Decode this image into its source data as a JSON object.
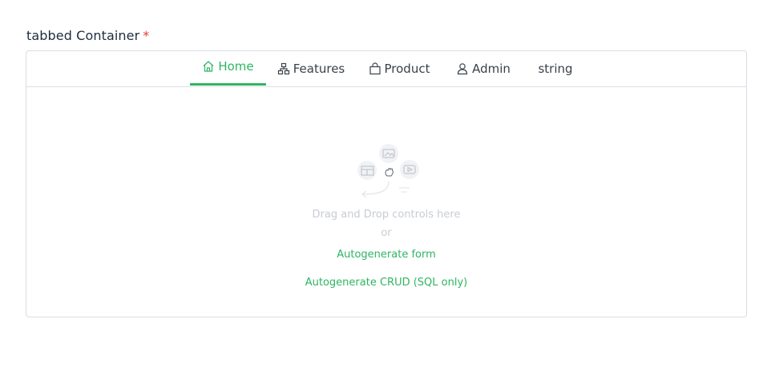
{
  "field": {
    "label": "tabbed Container",
    "required_marker": "*"
  },
  "tabs": [
    {
      "label": "Home",
      "icon": "home-icon",
      "active": true
    },
    {
      "label": "Features",
      "icon": "sitemap-icon",
      "active": false
    },
    {
      "label": "Product",
      "icon": "bag-icon",
      "active": false
    },
    {
      "label": "Admin",
      "icon": "user-icon",
      "active": false
    },
    {
      "label": "string",
      "icon": "",
      "active": false
    }
  ],
  "dropzone": {
    "hint": "Drag and Drop controls here",
    "or": "or",
    "autogenerate_form": "Autogenerate form",
    "autogenerate_crud": "Autogenerate CRUD (SQL only)"
  },
  "colors": {
    "accent": "#2eb562",
    "required": "#e53935",
    "border": "#d9dde3",
    "muted_text": "#c7ccd3"
  }
}
